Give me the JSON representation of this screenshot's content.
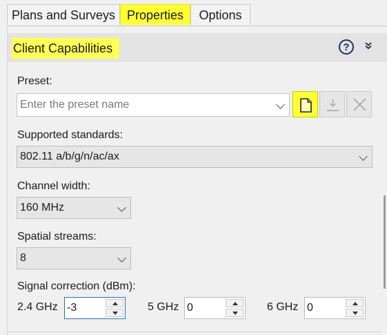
{
  "tabs": [
    {
      "label": "Plans and Surveys",
      "active": false
    },
    {
      "label": "Properties",
      "active": true
    },
    {
      "label": "Options",
      "active": false
    }
  ],
  "section": {
    "title": "Client Capabilities",
    "help_icon": "question-circle-icon",
    "collapse_icon": "double-chevron-down-icon"
  },
  "preset": {
    "label": "Preset:",
    "placeholder": "Enter the preset name",
    "value": "",
    "buttons": {
      "new": "new-preset-icon",
      "save": "save-preset-icon",
      "delete": "delete-preset-icon"
    }
  },
  "supported_standards": {
    "label": "Supported standards:",
    "value": "802.11 a/b/g/n/ac/ax"
  },
  "channel_width": {
    "label": "Channel width:",
    "value": "160 MHz"
  },
  "spatial_streams": {
    "label": "Spatial streams:",
    "value": "8"
  },
  "signal_correction": {
    "label": "Signal correction (dBm):",
    "bands": [
      {
        "label": "2.4 GHz",
        "value": "-3"
      },
      {
        "label": "5 GHz",
        "value": "0"
      },
      {
        "label": "6 GHz",
        "value": "0"
      }
    ]
  },
  "colors": {
    "highlight": "#ffff33",
    "focus": "#1a73c9"
  }
}
